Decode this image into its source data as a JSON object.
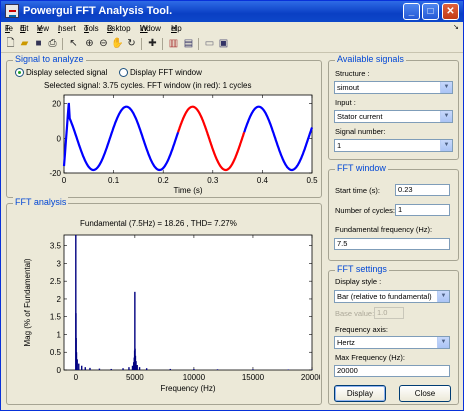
{
  "window": {
    "title": "Powergui FFT Analysis Tool."
  },
  "menu": [
    {
      "label": "File",
      "u": "F",
      "rest": "ile"
    },
    {
      "label": "Edit",
      "u": "E",
      "rest": "dit"
    },
    {
      "label": "View",
      "u": "V",
      "rest": "iew"
    },
    {
      "label": "Insert",
      "u": "I",
      "rest": "nsert"
    },
    {
      "label": "Tools",
      "u": "T",
      "rest": "ools"
    },
    {
      "label": "Desktop",
      "u": "D",
      "rest": "esktop"
    },
    {
      "label": "Window",
      "u": "W",
      "rest": "indow"
    },
    {
      "label": "Help",
      "u": "H",
      "rest": "elp"
    }
  ],
  "toolbar": [
    "new-file-icon",
    "open-folder-icon",
    "save-icon",
    "print-icon",
    "pointer-icon",
    "zoom-in-icon",
    "zoom-out-icon",
    "pan-hand-icon",
    "rotate-3d-icon",
    "data-cursor-icon",
    "colorbar-icon",
    "legend-icon",
    "hide-plot-tools-icon",
    "show-plot-tools-icon"
  ],
  "signal_panel": {
    "legend": "Signal to analyze",
    "radio_selected": "Display selected signal",
    "radio_fft": "Display FFT window",
    "plot_title": "Selected signal: 3.75 cycles. FFT window (in red): 1 cycles",
    "xlabel": "Time (s)"
  },
  "fft_panel": {
    "legend": "FFT analysis",
    "plot_title": "Fundamental (7.5Hz) = 18.26 , THD= 7.27%",
    "xlabel": "Frequency (Hz)",
    "ylabel": "Mag (% of Fundamental)"
  },
  "available_signals": {
    "legend": "Available signals",
    "structure_label": "Structure :",
    "structure_value": "simout",
    "input_label": "Input :",
    "input_value": "Stator current",
    "signal_number_label": "Signal number:",
    "signal_number_value": "1"
  },
  "fft_window": {
    "legend": "FFT window",
    "start_time_label": "Start time (s):",
    "start_time_value": "0.23",
    "cycles_label": "Number of cycles:",
    "cycles_value": "1",
    "fund_freq_label": "Fundamental frequency (Hz):",
    "fund_freq_value": "7.5"
  },
  "fft_settings": {
    "legend": "FFT settings",
    "display_style_label": "Display style :",
    "display_style_value": "Bar (relative to fundamental)",
    "base_value_label": "Base value:",
    "base_value_value": "1.0",
    "freq_axis_label": "Frequency axis:",
    "freq_axis_value": "Hertz",
    "max_freq_label": "Max Frequency (Hz):",
    "max_freq_value": "20000"
  },
  "buttons": {
    "display": "Display",
    "close": "Close"
  },
  "colors": {
    "signal": "#0000ff",
    "fft_window": "#ff0000",
    "bars": "#000080",
    "legend_text": "#0046d5"
  },
  "chart_data": [
    {
      "type": "line",
      "title": "Selected signal: 3.75 cycles. FFT window (in red): 1 cycles",
      "xlabel": "Time (s)",
      "ylabel": "",
      "xlim": [
        0,
        0.5
      ],
      "ylim": [
        -20,
        25
      ],
      "xticks": [
        0,
        0.1,
        0.2,
        0.3,
        0.4,
        0.5
      ],
      "yticks": [
        -20,
        0,
        20
      ],
      "signal": {
        "frequency_hz": 7.5,
        "amplitude": 18.26,
        "startup_peak": 22,
        "startup_end_s": 0.01
      },
      "series": [
        {
          "x_range": [
            0,
            0.23
          ],
          "color": "#0000ff"
        },
        {
          "x_range": [
            0.23,
            0.3633
          ],
          "color": "#ff0000"
        },
        {
          "x_range": [
            0.3633,
            0.5
          ],
          "color": "#0000ff"
        }
      ]
    },
    {
      "type": "bar",
      "title": "Fundamental (7.5Hz) = 18.26 , THD= 7.27%",
      "xlabel": "Frequency (Hz)",
      "ylabel": "Mag (% of Fundamental)",
      "xlim": [
        -1000,
        20000
      ],
      "ylim": [
        0,
        3.8
      ],
      "xticks": [
        0,
        5000,
        10000,
        15000,
        20000
      ],
      "yticks": [
        0,
        0.5,
        1,
        1.5,
        2,
        2.5,
        3,
        3.5
      ],
      "points": [
        [
          0,
          3.8
        ],
        [
          15,
          1.6
        ],
        [
          30,
          0.9
        ],
        [
          60,
          0.5
        ],
        [
          120,
          0.3
        ],
        [
          250,
          0.18
        ],
        [
          500,
          0.12
        ],
        [
          800,
          0.08
        ],
        [
          1200,
          0.06
        ],
        [
          2000,
          0.04
        ],
        [
          3000,
          0.03
        ],
        [
          4000,
          0.05
        ],
        [
          4500,
          0.08
        ],
        [
          4800,
          0.12
        ],
        [
          4900,
          0.22
        ],
        [
          4950,
          0.35
        ],
        [
          4980,
          0.55
        ],
        [
          5000,
          2.2
        ],
        [
          5020,
          0.6
        ],
        [
          5050,
          0.4
        ],
        [
          5100,
          0.25
        ],
        [
          5200,
          0.14
        ],
        [
          5400,
          0.08
        ],
        [
          6000,
          0.05
        ],
        [
          8000,
          0.03
        ],
        [
          10000,
          0.03
        ],
        [
          12000,
          0.02
        ],
        [
          15000,
          0.02
        ],
        [
          18000,
          0.015
        ],
        [
          20000,
          0.01
        ]
      ]
    }
  ]
}
